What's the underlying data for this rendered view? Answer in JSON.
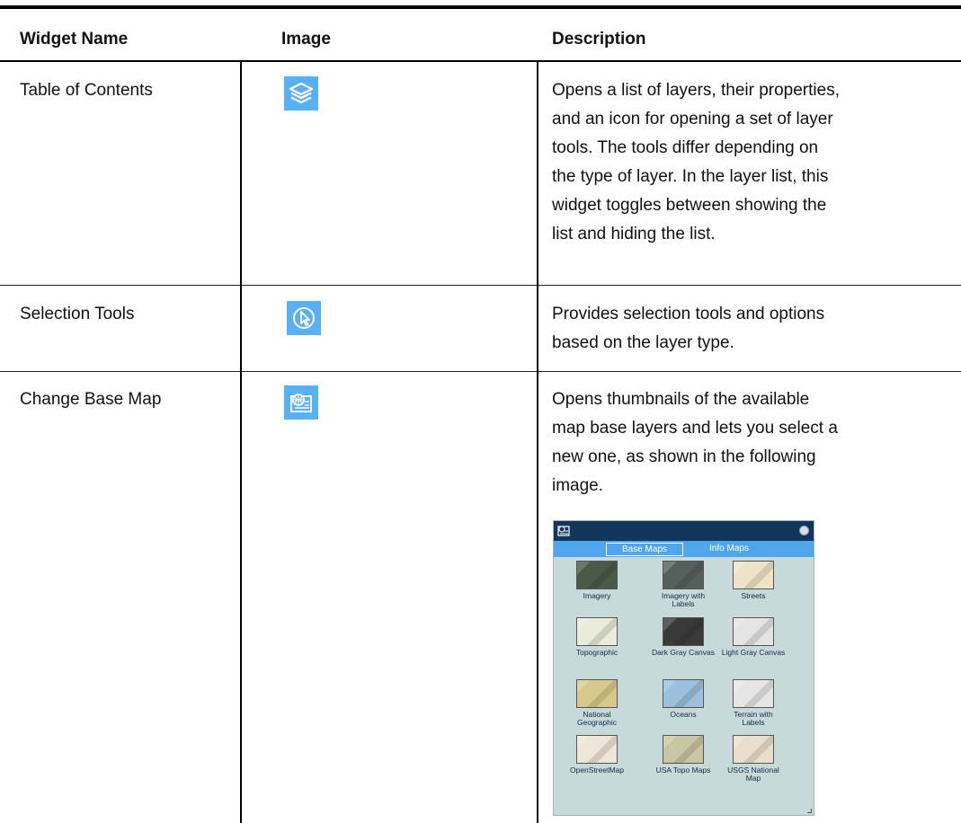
{
  "table": {
    "headers": {
      "name": "Widget Name",
      "image": "Image",
      "description": "Description"
    },
    "rows": [
      {
        "name": "Table of Contents",
        "icon": "layers-icon",
        "description": "Opens a list of layers, their properties, and an icon for opening a set of layer tools. The tools differ depending on the type of layer. In the layer list, this widget toggles between showing the list and hiding the list.",
        "lines": [
          "Opens a list of layers, their properties,",
          "and an icon for opening a set of layer",
          "tools. The tools differ depending on",
          "the type of layer. In the layer list, this",
          "widget toggles between showing the",
          "list and hiding the list."
        ]
      },
      {
        "name": "Selection Tools",
        "icon": "selection-cursor-icon",
        "lines": [
          "Provides selection tools and options",
          "based on the layer type."
        ]
      },
      {
        "name": "Change Base Map",
        "icon": "base-map-icon",
        "lines": [
          "Opens thumbnails of the available",
          "map base layers and lets you select a",
          "new one, as shown in the following",
          "image."
        ]
      }
    ]
  },
  "basemap_panel": {
    "tabs": [
      "Base Maps",
      "Info Maps"
    ],
    "active_tab": "Base Maps",
    "maps": [
      {
        "label_lines": [
          "Imagery"
        ],
        "color": "#4a5a48"
      },
      {
        "label_lines": [
          "Imagery with",
          "Labels"
        ],
        "color": "#55605a"
      },
      {
        "label_lines": [
          "Streets"
        ],
        "color": "#efe2c8"
      },
      {
        "label_lines": [
          "Topographic"
        ],
        "color": "#e9ecd8"
      },
      {
        "label_lines": [
          "Dark Gray Canvas"
        ],
        "color": "#3a3a3a"
      },
      {
        "label_lines": [
          "Light Gray Canvas"
        ],
        "color": "#e4e4e4"
      },
      {
        "label_lines": [
          "National",
          "Geographic"
        ],
        "color": "#d8c98a"
      },
      {
        "label_lines": [
          "Oceans"
        ],
        "color": "#9cc0de"
      },
      {
        "label_lines": [
          "Terrain with",
          "Labels"
        ],
        "color": "#e6e6e6"
      },
      {
        "label_lines": [
          "OpenStreetMap"
        ],
        "color": "#eee6d6"
      },
      {
        "label_lines": [
          "USA Topo Maps"
        ],
        "color": "#c9c6a4"
      },
      {
        "label_lines": [
          "USGS National",
          "Map"
        ],
        "color": "#e8e0c8"
      }
    ]
  },
  "colors": {
    "icon_bg": "#58b0f6",
    "panel_bar": "#12355c",
    "panel_tabs": "#4ea6ee",
    "panel_bg": "#c7d9d9"
  }
}
